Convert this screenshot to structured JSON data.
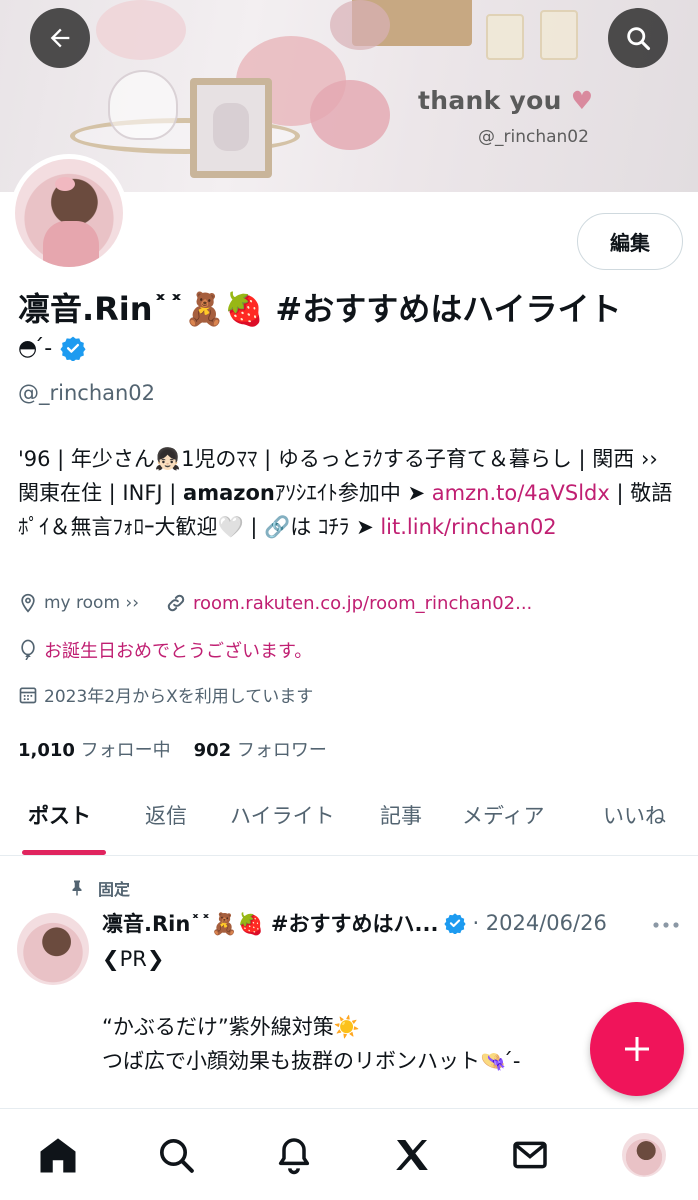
{
  "banner": {
    "title": "thank you",
    "heart": "♥",
    "handle": "@_rinchan02"
  },
  "profile": {
    "name": "凛音.Rin˟˟🧸🍓 #おすすめはハイライト",
    "name_suffix": "◓ ́-",
    "handle": "@_rinchan02",
    "edit_label": "編集",
    "bio_text_1": "'96 | 年少さん👧🏻1児のﾏﾏ | ゆるっとﾗｸする子育て＆暮らし | 関西 ›› 関東在住 | INFJ | 𝗮𝗺𝗮𝘇𝗼𝗻ｱｿｼｴｲﾄ参加中 ➤ ",
    "bio_link_1": "amzn.to/4aVSldx",
    "bio_text_2": " | 敬語ﾎﾟｲ＆無言ﾌｫﾛｰ大歓迎🤍 | 🔗は ｺﾁﾗ ➤ ",
    "bio_link_2": "lit.link/rinchan02",
    "location": "my room ››",
    "website": "room.rakuten.co.jp/room_rinchan02...",
    "birthday": "お誕生日おめでとうございます。",
    "joined": "2023年2月からXを利用しています",
    "following_count": "1,010",
    "following_label": "フォロー中",
    "followers_count": "902",
    "followers_label": "フォロワー"
  },
  "tabs": [
    "ポスト",
    "返信",
    "ハイライト",
    "記事",
    "メディア",
    "いいね"
  ],
  "post": {
    "pinned_label": "固定",
    "author": "凛音.Rin˟˟🧸🍓 #おすすめはハ...",
    "date": "· 2024/06/26",
    "text": "❮PR❯\n\n“かぶるだけ”紫外線対策☀️\nつば広で小顔効果も抜群のリボンハット👒 ́-\n\n今回お得なクーポンで購入させてもらったよ"
  },
  "colors": {
    "accent": "#e0245e",
    "link": "#c01f72",
    "verified": "#1d9bf0",
    "fab": "#f0145a"
  },
  "icons": {
    "back": "arrow-left-icon",
    "search": "search-icon",
    "location": "location-pin-icon",
    "link": "link-icon",
    "birthday": "balloon-icon",
    "calendar": "calendar-icon",
    "pin": "pin-icon",
    "more": "more-dots-icon",
    "compose": "plus-icon",
    "nav": [
      "home-icon",
      "search-icon",
      "bell-icon",
      "x-logo-icon",
      "mail-icon",
      "avatar"
    ]
  }
}
